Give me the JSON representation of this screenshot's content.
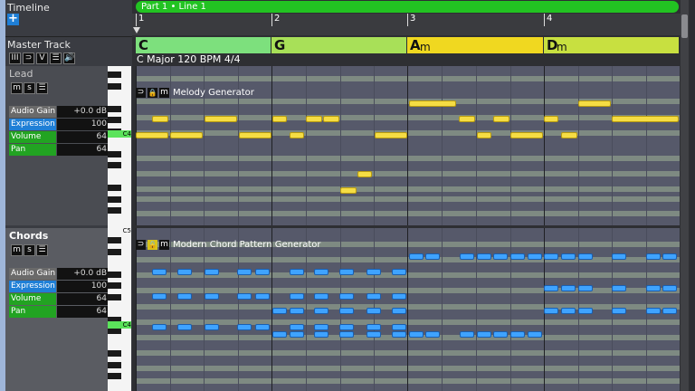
{
  "left_panel": {
    "timeline_label": "Timeline",
    "add_label": "+",
    "master_track_label": "Master Track",
    "master_buttons": [
      "III",
      "⊃",
      "V",
      "☰",
      "🔊"
    ],
    "tracks": [
      {
        "name": "Lead",
        "buttons": [
          "m",
          "s",
          "☰"
        ],
        "params": [
          {
            "label": "Audio Gain",
            "value": "+0.0 dB",
            "color": "#6a6a6a"
          },
          {
            "label": "Expression",
            "value": "100",
            "color": "#1f7fd6"
          },
          {
            "label": "Volume",
            "value": "64",
            "color": "#22a322"
          },
          {
            "label": "Pan",
            "value": "64",
            "color": "#22a322"
          }
        ]
      },
      {
        "name": "Chords",
        "buttons": [
          "m",
          "s",
          "☰"
        ],
        "params": [
          {
            "label": "Audio Gain",
            "value": "+0.0 dB",
            "color": "#6a6a6a"
          },
          {
            "label": "Expression",
            "value": "100",
            "color": "#1f7fd6"
          },
          {
            "label": "Volume",
            "value": "64",
            "color": "#22a322"
          },
          {
            "label": "Pan",
            "value": "64",
            "color": "#22a322"
          }
        ]
      }
    ]
  },
  "timeline": {
    "part_label": "Part 1 • Line 1",
    "measures": [
      "1",
      "2",
      "3",
      "4"
    ]
  },
  "chord_track": {
    "chords": [
      {
        "root": "C",
        "quality": "",
        "color": "#7de07d"
      },
      {
        "root": "G",
        "quality": "",
        "color": "#a8e058"
      },
      {
        "root": "A",
        "quality": "m",
        "color": "#f0d820"
      },
      {
        "root": "D",
        "quality": "m",
        "color": "#c8e040"
      }
    ],
    "info": "C Major  120 BPM  4/4"
  },
  "lead_region": {
    "generator_name": "Melody Generator"
  },
  "chords_region": {
    "generator_name": "Modern Chord Pattern Generator"
  },
  "piano_labels": {
    "c4_top": "C4",
    "c5": "C5",
    "c4_bottom": "C4"
  },
  "colors": {
    "melody_note": "#f5dd44",
    "chord_note": "#3fa3ff",
    "accent_green": "#22c322"
  }
}
